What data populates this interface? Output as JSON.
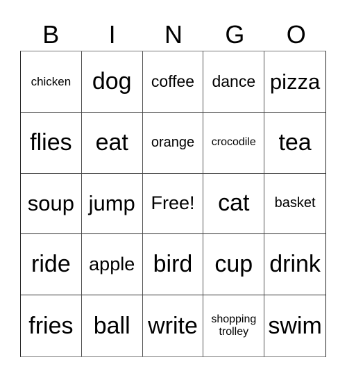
{
  "header": {
    "letters": [
      "B",
      "I",
      "N",
      "G",
      "O"
    ]
  },
  "card": {
    "rows": [
      [
        "chicken",
        "dog",
        "coffee",
        "dance",
        "pizza"
      ],
      [
        "flies",
        "eat",
        "orange",
        "crocodile",
        "tea"
      ],
      [
        "soup",
        "jump",
        "Free!",
        "cat",
        "basket"
      ],
      [
        "ride",
        "apple",
        "bird",
        "cup",
        "drink"
      ],
      [
        "fries",
        "ball",
        "write",
        "shopping trolley",
        "swim"
      ]
    ],
    "free_space": "Free!"
  }
}
